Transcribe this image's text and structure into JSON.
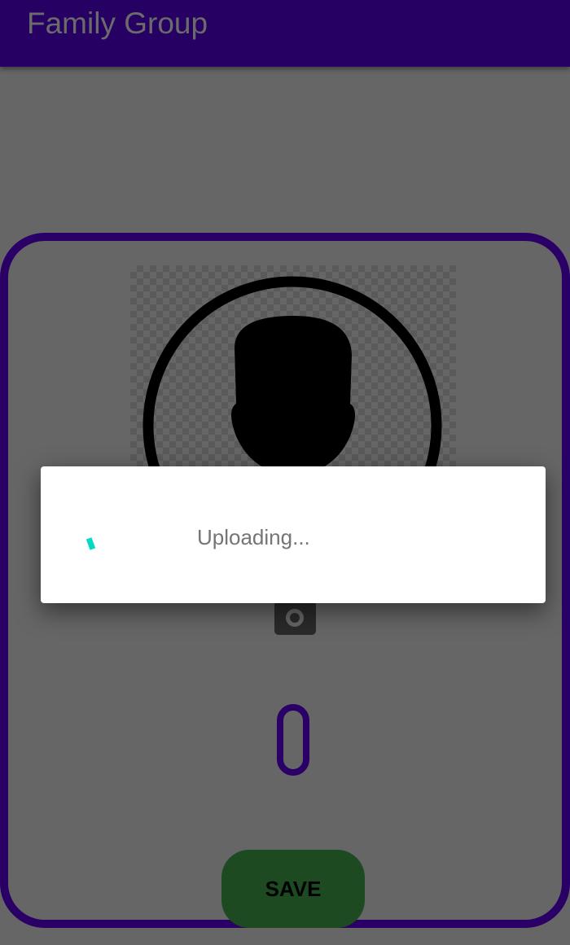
{
  "app_bar": {
    "title": "Family Group"
  },
  "form": {
    "save_label": "SAVE",
    "name_value": ""
  },
  "icons": {
    "avatar": "person-silhouette-icon",
    "camera": "camera-icon"
  },
  "dialog": {
    "message": "Uploading...",
    "progress": "indeterminate"
  },
  "colors": {
    "primary": "#3700b3",
    "accent": "#03dac5",
    "save_button": "#3ba03f"
  }
}
